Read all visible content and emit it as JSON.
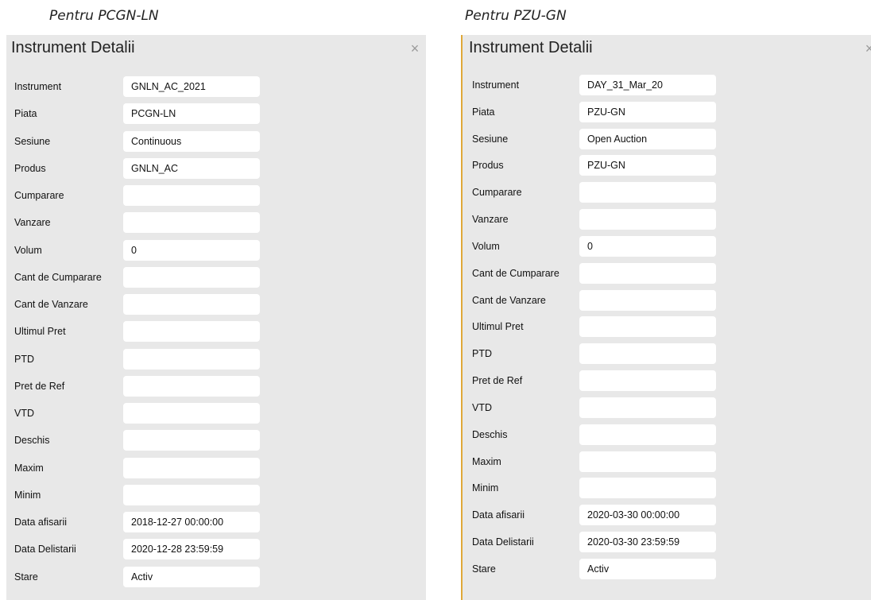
{
  "panels": [
    {
      "caption": "Pentru PCGN-LN",
      "title": "Instrument Detalii",
      "close_icon": "×",
      "fields": [
        {
          "label": "Instrument",
          "value": "GNLN_AC_2021"
        },
        {
          "label": "Piata",
          "value": "PCGN-LN"
        },
        {
          "label": "Sesiune",
          "value": "Continuous"
        },
        {
          "label": "Produs",
          "value": "GNLN_AC"
        },
        {
          "label": "Cumparare",
          "value": ""
        },
        {
          "label": "Vanzare",
          "value": ""
        },
        {
          "label": "Volum",
          "value": "0"
        },
        {
          "label": "Cant de Cumparare",
          "value": ""
        },
        {
          "label": "Cant de Vanzare",
          "value": ""
        },
        {
          "label": "Ultimul Pret",
          "value": ""
        },
        {
          "label": "PTD",
          "value": ""
        },
        {
          "label": "Pret de Ref",
          "value": ""
        },
        {
          "label": "VTD",
          "value": ""
        },
        {
          "label": "Deschis",
          "value": ""
        },
        {
          "label": "Maxim",
          "value": ""
        },
        {
          "label": "Minim",
          "value": ""
        },
        {
          "label": "Data afisarii",
          "value": "2018-12-27 00:00:00"
        },
        {
          "label": "Data Delistarii",
          "value": "2020-12-28 23:59:59"
        },
        {
          "label": "Stare",
          "value": "Activ"
        }
      ]
    },
    {
      "caption": "Pentru PZU-GN",
      "title": "Instrument Detalii",
      "close_icon": "×",
      "fields": [
        {
          "label": "Instrument",
          "value": "DAY_31_Mar_20"
        },
        {
          "label": "Piata",
          "value": "PZU-GN"
        },
        {
          "label": "Sesiune",
          "value": "Open Auction"
        },
        {
          "label": "Produs",
          "value": "PZU-GN"
        },
        {
          "label": "Cumparare",
          "value": ""
        },
        {
          "label": "Vanzare",
          "value": ""
        },
        {
          "label": "Volum",
          "value": "0"
        },
        {
          "label": "Cant de Cumparare",
          "value": ""
        },
        {
          "label": "Cant de Vanzare",
          "value": ""
        },
        {
          "label": "Ultimul Pret",
          "value": ""
        },
        {
          "label": "PTD",
          "value": ""
        },
        {
          "label": "Pret de Ref",
          "value": ""
        },
        {
          "label": "VTD",
          "value": ""
        },
        {
          "label": "Deschis",
          "value": ""
        },
        {
          "label": "Maxim",
          "value": ""
        },
        {
          "label": "Minim",
          "value": ""
        },
        {
          "label": "Data afisarii",
          "value": "2020-03-30 00:00:00"
        },
        {
          "label": "Data Delistarii",
          "value": "2020-03-30 23:59:59"
        },
        {
          "label": "Stare",
          "value": "Activ"
        }
      ]
    }
  ]
}
